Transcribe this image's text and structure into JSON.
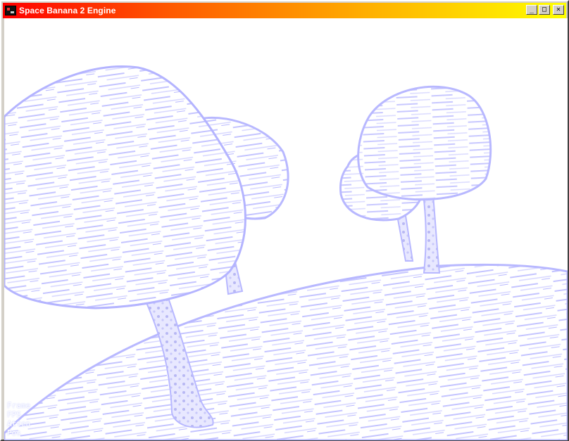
{
  "window": {
    "title": "Space Banana 2 Engine",
    "controls": {
      "minimize": "_",
      "maximize": "□",
      "close": "✕"
    }
  },
  "scene": {
    "tint": "#c8c8ff",
    "background": "#ffffff",
    "objects": [
      "hill",
      "tree",
      "tree",
      "tree",
      "tree"
    ]
  },
  "hud": {
    "lines": [
      "Frame",
      "FPS",
      "Atten",
      "Pos"
    ]
  },
  "colors": {
    "title_start": "#ff0000",
    "title_end": "#ffff00"
  }
}
